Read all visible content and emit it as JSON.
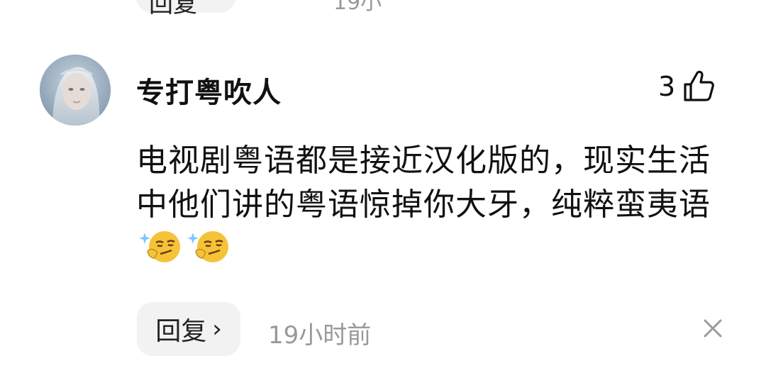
{
  "previous_item": {
    "reply_label": "回复",
    "time": "19小"
  },
  "comment": {
    "username": "专打粤吹人",
    "like_count": "3",
    "text": "电视剧粤语都是接近汉化版的，现实生活中他们讲的粤语惊掉你大牙，纯粹蛮夷语",
    "emojis": [
      "smirk-emoji",
      "smirk-emoji"
    ],
    "reply_label": "回复",
    "reply_chevron": "›",
    "time": "19小时前"
  },
  "icons": {
    "like": "thumbs-up-icon",
    "close": "close-icon",
    "avatar": "avatar"
  },
  "colors": {
    "text_primary": "#111111",
    "text_secondary": "#999999",
    "pill_bg": "#f2f2f2"
  }
}
